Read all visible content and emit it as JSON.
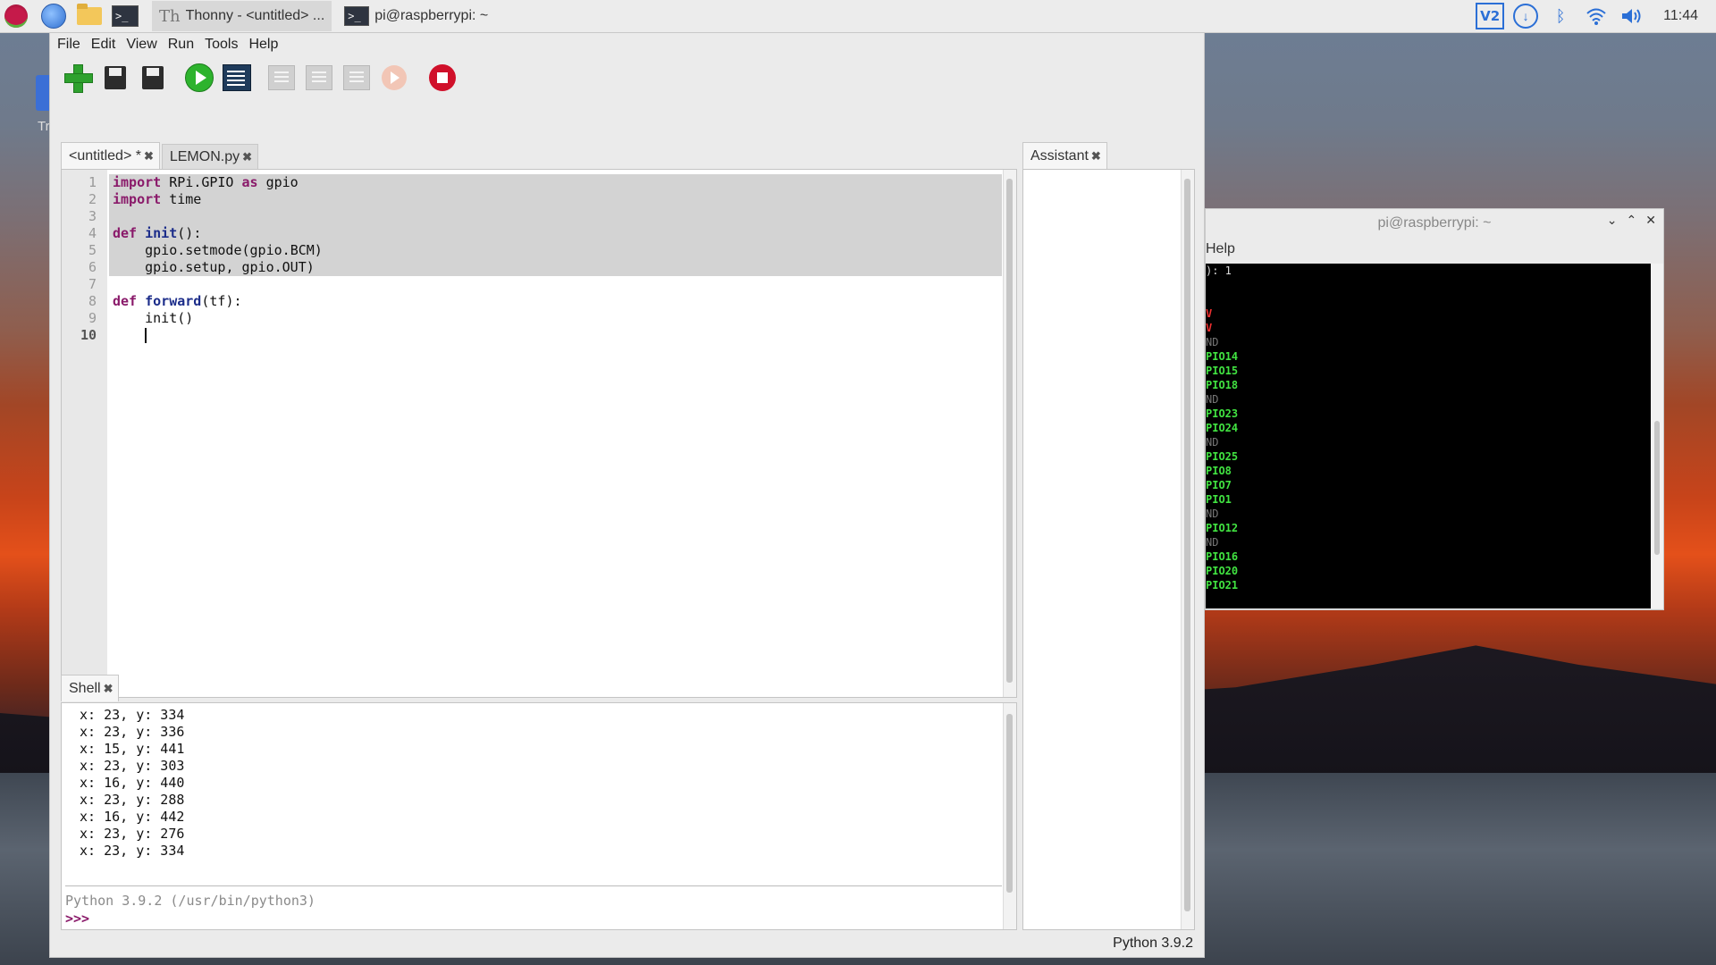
{
  "taskbar": {
    "tasks": [
      {
        "icon": "thonny-icon",
        "label": "Thonny  -  <untitled>  ..."
      },
      {
        "icon": "terminal-icon",
        "label": "pi@raspberrypi: ~"
      }
    ],
    "vnc_label": "V2",
    "clock": "11:44"
  },
  "desktop": {
    "trash_label": "Tr"
  },
  "thonny": {
    "menu": [
      "File",
      "Edit",
      "View",
      "Run",
      "Tools",
      "Help"
    ],
    "editor_tabs": [
      {
        "label": "<untitled> *"
      },
      {
        "label": "LEMON.py"
      }
    ],
    "code_lines": [
      {
        "num": "1",
        "text": "import RPi.GPIO as gpio"
      },
      {
        "num": "2",
        "text": "import time"
      },
      {
        "num": "3",
        "text": ""
      },
      {
        "num": "4",
        "text": "def init():"
      },
      {
        "num": "5",
        "text": "    gpio.setmode(gpio.BCM)"
      },
      {
        "num": "6",
        "text": "    gpio.setup, gpio.OUT)"
      },
      {
        "num": "7",
        "text": ""
      },
      {
        "num": "8",
        "text": "def forward(tf):"
      },
      {
        "num": "9",
        "text": "    init()"
      },
      {
        "num": "10",
        "text": "    "
      }
    ],
    "shell_tab": "Shell",
    "shell_lines": [
      "x: 23, y: 334",
      "x: 23, y: 336",
      "x: 15, y: 441",
      "x: 23, y: 303",
      "x: 16, y: 440",
      "x: 23, y: 288",
      "x: 16, y: 442",
      "x: 23, y: 276",
      "x: 23, y: 334"
    ],
    "shell_banner": "Python 3.9.2 (/usr/bin/python3)",
    "shell_prompt": ">>>",
    "assistant_tab": "Assistant",
    "status": "Python 3.9.2"
  },
  "terminal": {
    "title": "pi@raspberrypi: ~",
    "menu": "Help",
    "lines": [
      {
        "text": "): 1",
        "color": "white"
      },
      {
        "text": "",
        "color": "white"
      },
      {
        "text": "",
        "color": "white"
      },
      {
        "text": "V",
        "color": "red"
      },
      {
        "text": "V",
        "color": "red"
      },
      {
        "text": "ND",
        "color": "grey"
      },
      {
        "text": "PIO14",
        "color": "green"
      },
      {
        "text": "PIO15",
        "color": "green"
      },
      {
        "text": "PIO18",
        "color": "green"
      },
      {
        "text": "ND",
        "color": "grey"
      },
      {
        "text": "PIO23",
        "color": "green"
      },
      {
        "text": "PIO24",
        "color": "green"
      },
      {
        "text": "ND",
        "color": "grey"
      },
      {
        "text": "PIO25",
        "color": "green"
      },
      {
        "text": "PIO8",
        "color": "green"
      },
      {
        "text": "PIO7",
        "color": "green"
      },
      {
        "text": "PIO1",
        "color": "green"
      },
      {
        "text": "ND",
        "color": "grey"
      },
      {
        "text": "PIO12",
        "color": "green"
      },
      {
        "text": "ND",
        "color": "grey"
      },
      {
        "text": "PIO16",
        "color": "green"
      },
      {
        "text": "PIO20",
        "color": "green"
      },
      {
        "text": "PIO21",
        "color": "green"
      }
    ]
  },
  "colors": {
    "keyword": "#8a1a6a",
    "function_name": "#1c2d8a",
    "selection": "#d3d3d3",
    "terminal_green": "#41e241",
    "terminal_red": "#ee3030"
  }
}
